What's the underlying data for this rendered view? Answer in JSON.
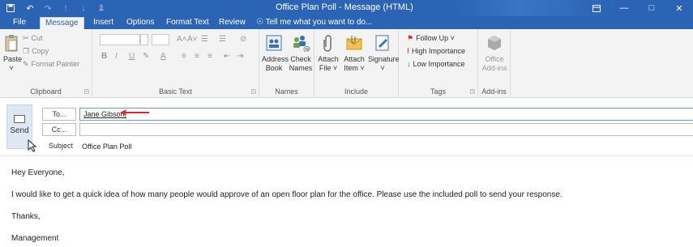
{
  "window": {
    "title": "Office Plan Poll - Message (HTML)",
    "qat": [
      "save-icon",
      "undo-icon",
      "redo-icon",
      "up-icon",
      "down-icon",
      "customize-icon"
    ],
    "controls": [
      "ribbon-display-icon",
      "minimize-icon",
      "maximize-icon",
      "close-icon"
    ]
  },
  "tabs": [
    "File",
    "Message",
    "Insert",
    "Options",
    "Format Text",
    "Review"
  ],
  "active_tab": "Message",
  "tell_me": "Tell me what you want to do...",
  "ribbon": {
    "clipboard": {
      "label": "Clipboard",
      "paste": "Paste",
      "cut": "Cut",
      "copy": "Copy",
      "format_painter": "Format Painter"
    },
    "basic_text": {
      "label": "Basic Text",
      "bold": "B",
      "italic": "I",
      "underline": "U",
      "grow": "A˄",
      "shrink": "A˅"
    },
    "names": {
      "label": "Names",
      "address_book_1": "Address",
      "address_book_2": "Book",
      "check_names_1": "Check",
      "check_names_2": "Names"
    },
    "include": {
      "label": "Include",
      "attach_file_1": "Attach",
      "attach_file_2": "File ˅",
      "attach_item_1": "Attach",
      "attach_item_2": "Item ˅",
      "signature_1": "Signature",
      "signature_2": "˅"
    },
    "tags": {
      "label": "Tags",
      "follow_up": "Follow Up ˅",
      "high_importance": "High Importance",
      "low_importance": "Low Importance"
    },
    "addins": {
      "label": "Add-ins",
      "office_1": "Office",
      "office_2": "Add-ins"
    }
  },
  "message": {
    "send": "Send",
    "to_button": "To...",
    "cc_button": "Cc...",
    "to_value": "Jane Gibson;",
    "cc_value": "",
    "subject_label": "Subject",
    "subject_value": "Office Plan Poll",
    "body": {
      "greeting": "Hey Everyone,",
      "paragraph": "I would like to get a quick idea of how many people would approve of an open floor plan for the office. Please use the included poll to send your response.",
      "closing": "Thanks,",
      "signature": "Management"
    }
  },
  "colors": {
    "titlebar": "#2b63b5",
    "ribbon_bg": "#f3f3f3",
    "arrow": "#d62828"
  }
}
